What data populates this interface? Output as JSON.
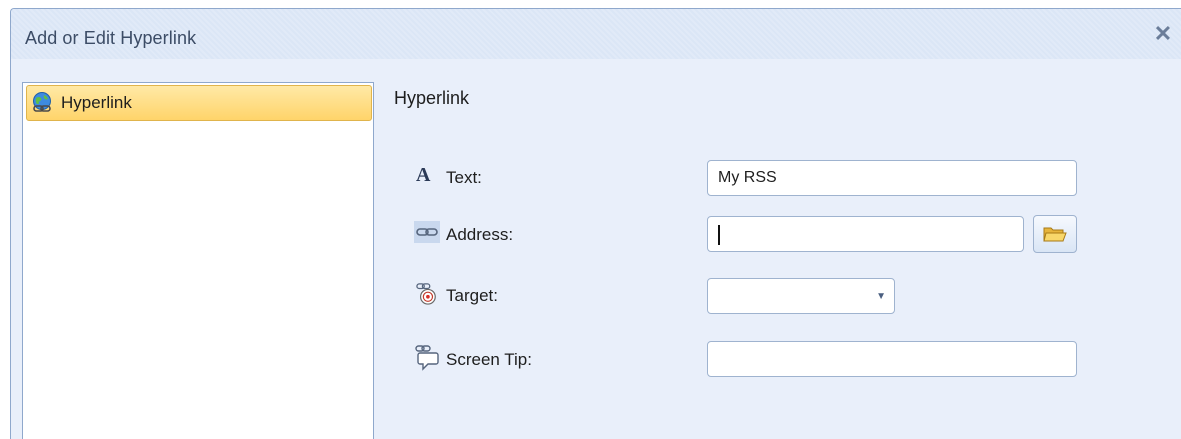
{
  "dialog": {
    "title": "Add or Edit Hyperlink",
    "close_glyph": "✕"
  },
  "nav": {
    "items": [
      {
        "label": "Hyperlink",
        "icon": "globe-link-icon",
        "selected": true
      }
    ]
  },
  "form": {
    "section_title": "Hyperlink",
    "text": {
      "label": "Text:",
      "value": "My RSS",
      "icon": "font-a-icon"
    },
    "address": {
      "label": "Address:",
      "value": "",
      "icon": "chain-link-icon",
      "browse_icon": "folder-open-icon"
    },
    "target": {
      "label": "Target:",
      "value": "",
      "icon": "target-link-icon"
    },
    "screen_tip": {
      "label": "Screen Tip:",
      "value": "",
      "icon": "tooltip-link-icon"
    }
  },
  "colors": {
    "dialog_bg": "#e9effa",
    "titlebar_bg": "#dbe6f6",
    "selection_bg": "#ffd46a",
    "border": "#8fa8cc"
  }
}
